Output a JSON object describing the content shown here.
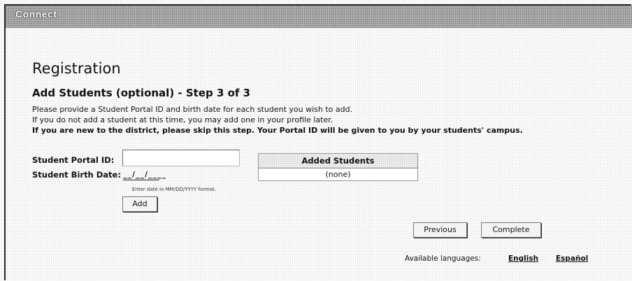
{
  "app": {
    "logo_text": "Connect"
  },
  "page": {
    "title": "Registration",
    "step_heading": "Add Students (optional) - Step 3 of 3",
    "instructions": [
      "Please provide a Student Portal ID and birth date for each student you wish to add.",
      "If you do not add a student at this time, you may add one in your profile later.",
      "If you are new to the district, please skip this step. Your Portal ID will be given to you by your students' campus."
    ]
  },
  "form": {
    "portal_id_label": "Student Portal ID:",
    "portal_id_value": "",
    "birth_date_label": "Student Birth Date:",
    "birth_date_value": "__/__/____",
    "birth_date_hint": "Enter date in MM/DD/YYYY format.",
    "add_label": "Add"
  },
  "added_students": {
    "header": "Added Students",
    "empty_text": "(none)"
  },
  "actions": {
    "previous_label": "Previous",
    "complete_label": "Complete"
  },
  "languages": {
    "label": "Available languages:",
    "options": [
      "English",
      "Español"
    ]
  }
}
